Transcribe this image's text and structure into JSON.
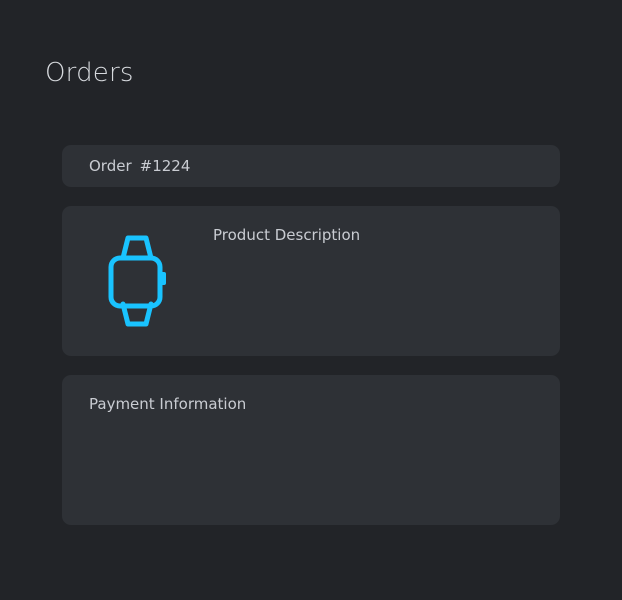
{
  "page": {
    "title": "Orders"
  },
  "order": {
    "label": "Order",
    "number": "#1224"
  },
  "product": {
    "label": "Product Description",
    "icon": "smartwatch-icon",
    "icon_color": "#19c3ff"
  },
  "payment": {
    "label": "Payment Information"
  },
  "colors": {
    "background": "#222428",
    "card": "#2e3136",
    "text": "#c9ccd2",
    "accent": "#19c3ff"
  }
}
